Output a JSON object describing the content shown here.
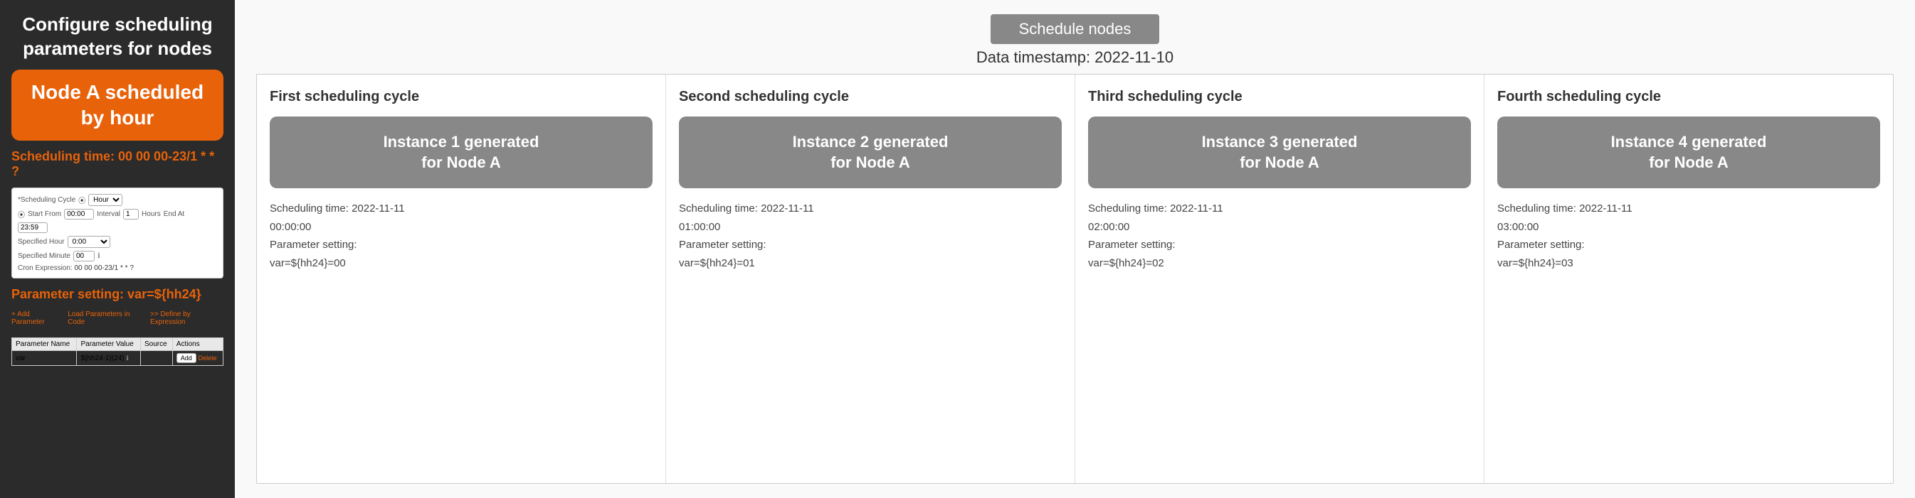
{
  "leftPanel": {
    "title": "Configure scheduling\nparameters for nodes",
    "nodeButton": "Node A scheduled\nby hour",
    "schedulingTime": "Scheduling time: 00 00 00-23/1 * * ?",
    "configForm": {
      "schedulingCycleLabel": "*Scheduling Cycle",
      "schedulingCycleValue": "Hour",
      "startFromLabel": "Start From",
      "startFromValue": "00:00",
      "intervalLabel": "Interval",
      "intervalValue": "1",
      "hoursLabel": "Hours",
      "endAtLabel": "End At",
      "endAtValue": "23:59",
      "specifiedHourLabel": "Specified Hour",
      "specifiedHourValue": "0:00",
      "specifiedMinuteLabel": "Specified Minute",
      "specifiedMinuteValue": "00",
      "cronExprLabel": "Cron Expression:",
      "cronExprValue": "00 00 00-23/1 * * ?"
    },
    "parameterSettingLabel": "Parameter setting: var=${hh24}",
    "paramActions": {
      "addParam": "+ Add Parameter",
      "loadFile": "Load Parameters in Code",
      "defineByExpr": ">> Define by Expression"
    },
    "paramTable": {
      "headers": [
        "Parameter Name",
        "Parameter Value",
        "Source",
        "Actions"
      ],
      "rows": [
        {
          "name": "var",
          "value": "${hh24-1}(24)",
          "source": "",
          "actions": [
            "Add",
            "Delete"
          ]
        }
      ]
    }
  },
  "rightPanel": {
    "headerButton": "Schedule nodes",
    "dataTimestamp": "Data timestamp: 2022-11-10",
    "cycles": [
      {
        "title": "First scheduling cycle",
        "instanceLabel": "Instance 1 generated\nfor Node A",
        "schedulingTime": "Scheduling time: 2022-11-11\n00:00:00",
        "parameterSetting": "Parameter setting:\nvar=${hh24}=00"
      },
      {
        "title": "Second scheduling cycle",
        "instanceLabel": "Instance 2 generated\nfor Node A",
        "schedulingTime": "Scheduling time: 2022-11-11\n01:00:00",
        "parameterSetting": "Parameter setting:\nvar=${hh24}=01"
      },
      {
        "title": "Third scheduling cycle",
        "instanceLabel": "Instance 3 generated\nfor Node A",
        "schedulingTime": "Scheduling time: 2022-11-11\n02:00:00",
        "parameterSetting": "Parameter setting:\nvar=${hh24}=02"
      },
      {
        "title": "Fourth scheduling cycle",
        "instanceLabel": "Instance 4 generated\nfor Node A",
        "schedulingTime": "Scheduling time: 2022-11-11\n03:00:00",
        "parameterSetting": "Parameter setting:\nvar=${hh24}=03"
      }
    ]
  }
}
